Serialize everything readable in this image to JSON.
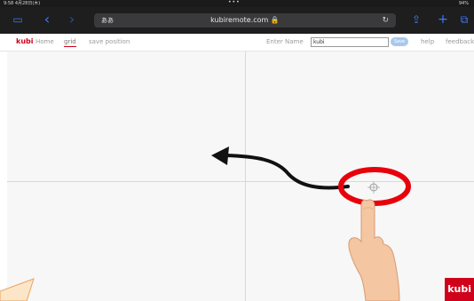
{
  "status_bar": {
    "time": "9:58  4月28日(木)",
    "dots": "•••",
    "battery": "94%"
  },
  "browser": {
    "text_size_label": "ああ",
    "url": "kubiremote.com 🔒",
    "reload_icon": "↻",
    "sidebar_icon": "▭",
    "back_icon": "‹",
    "forward_icon": "›",
    "share_icon": "⇪",
    "new_tab_icon": "+",
    "tabs_icon": "⧉"
  },
  "app_bar": {
    "logo": "kubi",
    "nav_home": "Home",
    "nav_grid": "grid",
    "nav_save_position": "save position",
    "enter_name_label": "Enter Name",
    "name_value": "kubi",
    "save_label": "Save",
    "help_label": "help",
    "feedback_label": "feedback"
  },
  "badge": {
    "text": "kubi"
  },
  "colors": {
    "brand_red": "#d0021b",
    "safari_blue": "#3a7bff",
    "grid_bg": "#f7f7f7",
    "annotation_red": "#e8000b"
  }
}
